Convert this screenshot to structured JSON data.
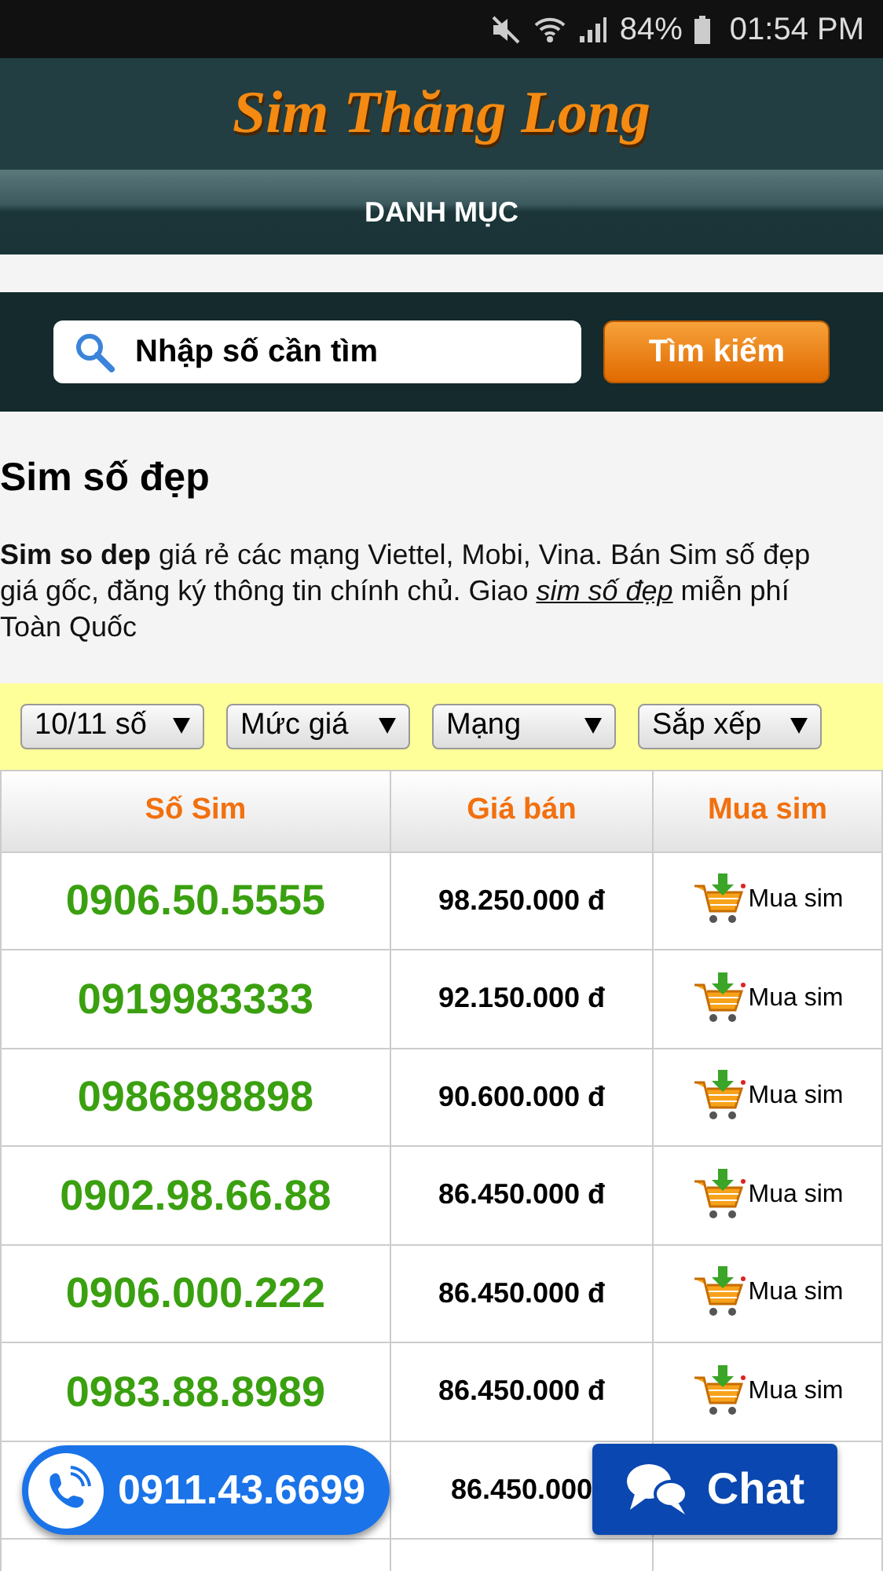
{
  "status_bar": {
    "battery": "84%",
    "time": "01:54 PM"
  },
  "header": {
    "logo": "Sim Thăng Long"
  },
  "nav": {
    "label": "DANH MỤC"
  },
  "search": {
    "placeholder": "Nhập số cần tìm",
    "button": "Tìm kiếm"
  },
  "heading": "Sim số đẹp",
  "intro": {
    "text": "**Sim so dep** giá rẻ các mạng Viettel, Mobi, Vina. Bán Sim số đẹp giá gốc, đăng ký thông tin chính chủ. Giao ",
    "link": "sim số đẹp",
    "after": " miễn phí Toàn Quốc"
  },
  "filters": [
    "10/11 số",
    "Mức giá",
    "Mạng",
    "Sắp xếp"
  ],
  "table": {
    "columns": [
      "Số Sim",
      "Giá bán",
      "Mua sim"
    ],
    "rows": [
      {
        "number": "0906.50.5555",
        "price": "98.250.000 đ",
        "buy": "Mua sim"
      },
      {
        "number": "0919983333",
        "price": "92.150.000 đ",
        "buy": "Mua sim"
      },
      {
        "number": "0986898898",
        "price": "90.600.000 đ",
        "buy": "Mua sim"
      },
      {
        "number": "0902.98.66.88",
        "price": "86.450.000 đ",
        "buy": "Mua sim"
      },
      {
        "number": "0906.000.222",
        "price": "86.450.000 đ",
        "buy": "Mua sim"
      },
      {
        "number": "0983.88.8989",
        "price": "86.450.000 đ",
        "buy": "Mua sim"
      },
      {
        "price": "86.450.000"
      },
      {}
    ]
  },
  "call_button": "0911.43.6699",
  "chat_button": "Chat"
}
